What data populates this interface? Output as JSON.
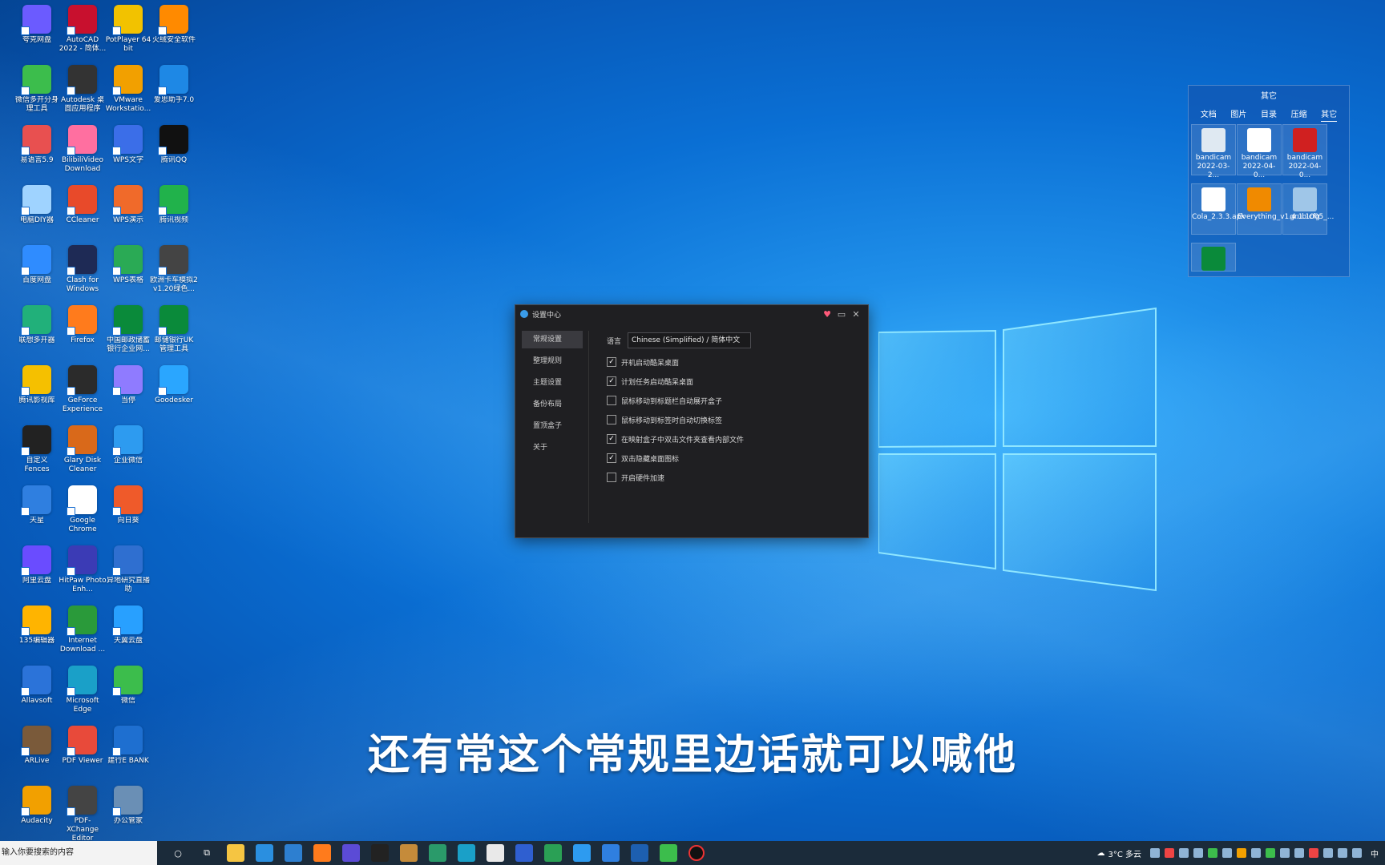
{
  "desktop_icons": [
    {
      "label": "夸克网盘",
      "color": "#6b5bff",
      "col": 1,
      "row": 0
    },
    {
      "label": "AutoCAD 2022 - 简体...",
      "color": "#c8102e",
      "col": 2,
      "row": 0
    },
    {
      "label": "PotPlayer 64 bit",
      "color": "#f2c200",
      "col": 3,
      "row": 0
    },
    {
      "label": "火绒安全软件",
      "color": "#ff8a00",
      "col": 4,
      "row": 0
    },
    {
      "label": "微信多开分身 理工具",
      "color": "#3cbd4c",
      "col": 1,
      "row": 1
    },
    {
      "label": "Autodesk 桌面应用程序",
      "color": "#333333",
      "col": 2,
      "row": 1
    },
    {
      "label": "VMware Workstatio...",
      "color": "#f2a000",
      "col": 3,
      "row": 1
    },
    {
      "label": "爱思助手7.0",
      "color": "#1e88e5",
      "col": 4,
      "row": 1
    },
    {
      "label": "易语言5.9",
      "color": "#e85050",
      "col": 1,
      "row": 2
    },
    {
      "label": "BilibiliVideo Download",
      "color": "#ff6fa0",
      "col": 2,
      "row": 2
    },
    {
      "label": "WPS文字",
      "color": "#3b6ee8",
      "col": 3,
      "row": 2
    },
    {
      "label": "腾讯QQ",
      "color": "#111111",
      "col": 4,
      "row": 2
    },
    {
      "label": "电脑DIY器",
      "color": "#9fd3ff",
      "col": 1,
      "row": 3
    },
    {
      "label": "CCleaner",
      "color": "#e84a2a",
      "col": 2,
      "row": 3
    },
    {
      "label": "WPS演示",
      "color": "#f06a2a",
      "col": 3,
      "row": 3
    },
    {
      "label": "腾讯视频",
      "color": "#21b24b",
      "col": 4,
      "row": 3
    },
    {
      "label": "百度网盘",
      "color": "#2f8cff",
      "col": 1,
      "row": 4
    },
    {
      "label": "Clash for Windows",
      "color": "#1e2a55",
      "col": 2,
      "row": 4
    },
    {
      "label": "WPS表格",
      "color": "#2aaa55",
      "col": 3,
      "row": 4
    },
    {
      "label": "欧洲卡车模拟2 v1.20绿色...",
      "color": "#444444",
      "col": 4,
      "row": 4
    },
    {
      "label": "联想多开器",
      "color": "#21b07a",
      "col": 1,
      "row": 5
    },
    {
      "label": "Firefox",
      "color": "#ff7b1c",
      "col": 2,
      "row": 5
    },
    {
      "label": "中国邮政储蓄银行企业网...",
      "color": "#0a8a3a",
      "col": 3,
      "row": 5
    },
    {
      "label": "邮储银行UK 管理工具",
      "color": "#0a8a3a",
      "col": 4,
      "row": 5
    },
    {
      "label": "腾讯影视库",
      "color": "#f5c000",
      "col": 1,
      "row": 6
    },
    {
      "label": "GeForce Experience",
      "color": "#2b2b2b",
      "col": 2,
      "row": 6
    },
    {
      "label": "当停",
      "color": "#8f7bff",
      "col": 3,
      "row": 6
    },
    {
      "label": "Goodesker",
      "color": "#2aa6ff",
      "col": 4,
      "row": 6
    },
    {
      "label": "自定义 Fences",
      "color": "#222222",
      "col": 1,
      "row": 7
    },
    {
      "label": "Glary Disk Cleaner",
      "color": "#d9691a",
      "col": 2,
      "row": 7
    },
    {
      "label": "企业微信",
      "color": "#2d9bf0",
      "col": 3,
      "row": 7
    },
    {
      "label": "天星",
      "color": "#2f7fe0",
      "col": 1,
      "row": 8
    },
    {
      "label": "Google Chrome",
      "color": "#ffffff",
      "col": 2,
      "row": 8
    },
    {
      "label": "向日葵",
      "color": "#ef5a2a",
      "col": 3,
      "row": 8
    },
    {
      "label": "阿里云盘",
      "color": "#6a4cff",
      "col": 1,
      "row": 9
    },
    {
      "label": "HitPaw Photo Enh...",
      "color": "#3b3bb5",
      "col": 2,
      "row": 9
    },
    {
      "label": "异地研究直播助",
      "color": "#2f6fd0",
      "col": 3,
      "row": 9
    },
    {
      "label": "135编辑器",
      "color": "#ffb400",
      "col": 1,
      "row": 10
    },
    {
      "label": "Internet Download ...",
      "color": "#2a9a3a",
      "col": 2,
      "row": 10
    },
    {
      "label": "天翼云盘",
      "color": "#28a0ff",
      "col": 3,
      "row": 10
    },
    {
      "label": "Allavsoft",
      "color": "#2b73d9",
      "col": 1,
      "row": 11
    },
    {
      "label": "Microsoft Edge",
      "color": "#1aa0c8",
      "col": 2,
      "row": 11
    },
    {
      "label": "微信",
      "color": "#3cbd4c",
      "col": 3,
      "row": 11
    },
    {
      "label": "ARLive",
      "color": "#7a5a3a",
      "col": 1,
      "row": 12
    },
    {
      "label": "PDF Viewer",
      "color": "#e84a3a",
      "col": 2,
      "row": 12
    },
    {
      "label": "建行E BANK",
      "color": "#1e6fd0",
      "col": 3,
      "row": 12
    },
    {
      "label": "Audacity",
      "color": "#f2a000",
      "col": 1,
      "row": 13
    },
    {
      "label": "PDF-XChange Editor",
      "color": "#444444",
      "col": 2,
      "row": 13
    },
    {
      "label": "办公管家",
      "color": "#6a8fb5",
      "col": 3,
      "row": 13
    }
  ],
  "fence": {
    "title": "其它",
    "tabs": [
      "文档",
      "图片",
      "目录",
      "压缩",
      "其它"
    ],
    "active_tab": "其它",
    "files": [
      {
        "label": "bandicam 2022-03-2...",
        "color": "#dfe9f2"
      },
      {
        "label": "bandicam 2022-04-0...",
        "color": "#ffffff"
      },
      {
        "label": "bandicam 2022-04-0...",
        "color": "#d02020"
      },
      {
        "label": "Cola_2.3.3.apk",
        "color": "#ffffff"
      },
      {
        "label": "Everything_v1.4.1.1005_...",
        "color": "#f08a00"
      },
      {
        "label": "grub.cfg",
        "color": "#9fc6e8"
      },
      {
        "label": "",
        "color": "#0a8a3a"
      }
    ]
  },
  "dialog": {
    "title": "设置中心",
    "sidebar": [
      "常规设置",
      "整理规则",
      "主题设置",
      "备份布局",
      "置顶盒子",
      "关于"
    ],
    "active_index": 0,
    "language_label": "语言",
    "language_value": "Chinese (Simplified) / 简体中文",
    "options": [
      {
        "label": "开机启动酷呆桌面",
        "checked": true
      },
      {
        "label": "计划任务启动酷呆桌面",
        "checked": true
      },
      {
        "label": "鼠标移动到标题栏自动展开盒子",
        "checked": false
      },
      {
        "label": "鼠标移动到标签时自动切换标签",
        "checked": false
      },
      {
        "label": "在映射盒子中双击文件夹查看内部文件",
        "checked": true
      },
      {
        "label": "双击隐藏桌面图标",
        "checked": true
      },
      {
        "label": "开启硬件加速",
        "checked": false
      }
    ]
  },
  "subtitle": "还有常这个常规里边话就可以喊他",
  "taskbar": {
    "search_placeholder": "输入你要搜索的内容",
    "weather": "3°C  多云",
    "ime": "中"
  }
}
